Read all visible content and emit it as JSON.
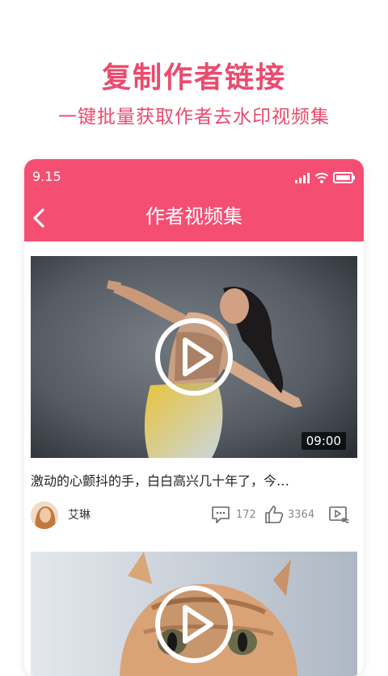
{
  "promo": {
    "title": "复制作者链接",
    "subtitle": "一键批量获取作者去水印视频集"
  },
  "status_bar": {
    "time": "9.15",
    "icons": [
      "signal-icon",
      "wifi-icon",
      "battery-icon"
    ]
  },
  "nav": {
    "back_icon": "chevron-left-icon",
    "title": "作者视频集"
  },
  "colors": {
    "accent": "#f44f73",
    "promo_text": "#ec4a6e"
  },
  "videos": [
    {
      "duration": "09:00",
      "caption": "激动的心颤抖的手，白白高兴几十年了，今…",
      "author": "艾琳",
      "comments": "172",
      "likes": "3364",
      "thumbnail": "dancer"
    },
    {
      "thumbnail": "cat"
    }
  ]
}
